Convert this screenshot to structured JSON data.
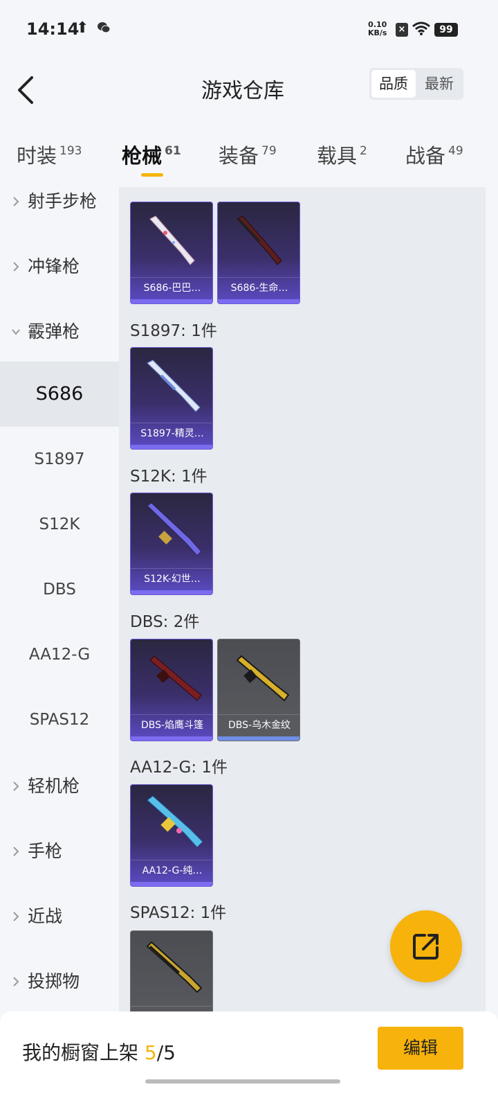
{
  "status": {
    "time": "14:14",
    "speed_value": "0.10",
    "speed_unit": "KB/s",
    "battery": "99"
  },
  "header": {
    "title": "游戏仓库",
    "sort_options": [
      "品质",
      "最新"
    ],
    "active_sort": "品质"
  },
  "tabs": [
    {
      "label": "时装",
      "count": "193",
      "active": false
    },
    {
      "label": "枪械",
      "count": "61",
      "active": true
    },
    {
      "label": "装备",
      "count": "79",
      "active": false
    },
    {
      "label": "载具",
      "count": "2",
      "active": false
    },
    {
      "label": "战备",
      "count": "49",
      "active": false
    }
  ],
  "sidebar": {
    "categories_before": [
      "射手步枪",
      "冲锋枪"
    ],
    "expanded_category": "霰弹枪",
    "subitems": [
      "S686",
      "S1897",
      "S12K",
      "DBS",
      "AA12-G",
      "SPAS12"
    ],
    "active_subitem": "S686",
    "categories_after": [
      "轻机枪",
      "手枪",
      "近战",
      "投掷物"
    ]
  },
  "groups": [
    {
      "title": "",
      "items": [
        {
          "name": "S686-巴巴…",
          "rarity": "purple"
        },
        {
          "name": "S686-生命…",
          "rarity": "purple"
        }
      ]
    },
    {
      "title": "S1897: 1件",
      "items": [
        {
          "name": "S1897-精灵…",
          "rarity": "purple"
        }
      ]
    },
    {
      "title": "S12K: 1件",
      "items": [
        {
          "name": "S12K-幻世…",
          "rarity": "purple"
        }
      ]
    },
    {
      "title": "DBS: 2件",
      "items": [
        {
          "name": "DBS-焰鹰斗篷",
          "rarity": "purple"
        },
        {
          "name": "DBS-乌木金纹",
          "rarity": "gray"
        }
      ]
    },
    {
      "title": "AA12-G: 1件",
      "items": [
        {
          "name": "AA12-G-纯…",
          "rarity": "purple"
        }
      ]
    },
    {
      "title": "SPAS12: 1件",
      "items": [
        {
          "name": "",
          "rarity": "gray"
        }
      ]
    }
  ],
  "bottom": {
    "showcase_prefix": "我的橱窗上架 ",
    "showcase_current": "5",
    "showcase_total": "/5",
    "edit_label": "编辑"
  },
  "colors": {
    "accent": "#f5b50a",
    "purple_rarity": "#5b4bc4",
    "gray_rarity": "#5a5c61"
  },
  "icons": [
    "upload-icon",
    "wechat-icon",
    "close-notification-icon",
    "wifi-icon",
    "battery-icon",
    "back-arrow-icon",
    "chevron-right-icon",
    "chevron-down-icon",
    "share-export-icon"
  ]
}
